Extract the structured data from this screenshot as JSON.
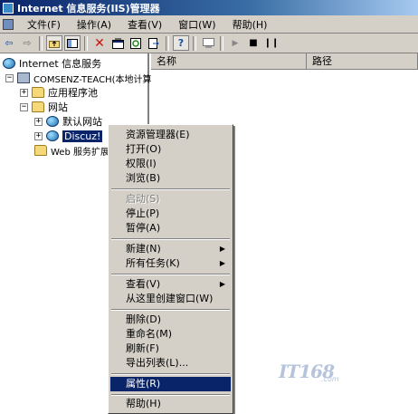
{
  "window": {
    "title": "Internet 信息服务(IIS)管理器"
  },
  "menubar": {
    "items": [
      "文件(F)",
      "操作(A)",
      "查看(V)",
      "窗口(W)",
      "帮助(H)"
    ]
  },
  "toolbar": {
    "buttons": [
      "back-arrow",
      "forward-arrow",
      "up-folder",
      "show-hide-tree",
      "delete",
      "properties",
      "refresh",
      "export-list",
      "help",
      "console",
      "play",
      "stop",
      "pause"
    ]
  },
  "tree": {
    "root": "Internet 信息服务",
    "computer": "COMSENZ-TEACH(本地计算",
    "app_pools": "应用程序池",
    "websites": "网站",
    "default_site": "默认网站",
    "selected_site": "Discuz!",
    "web_ext": "Web 服务扩展"
  },
  "list": {
    "columns": [
      "名称",
      "路径"
    ]
  },
  "context_menu": {
    "items": [
      {
        "label": "资源管理器(E)",
        "enabled": true
      },
      {
        "label": "打开(O)",
        "enabled": true
      },
      {
        "label": "权限(I)",
        "enabled": true
      },
      {
        "label": "浏览(B)",
        "enabled": true
      },
      {
        "label": "启动(S)",
        "enabled": false
      },
      {
        "label": "停止(P)",
        "enabled": true
      },
      {
        "label": "暂停(A)",
        "enabled": true
      },
      {
        "label": "新建(N)",
        "enabled": true,
        "submenu": true
      },
      {
        "label": "所有任务(K)",
        "enabled": true,
        "submenu": true
      },
      {
        "label": "查看(V)",
        "enabled": true,
        "submenu": true
      },
      {
        "label": "从这里创建窗口(W)",
        "enabled": true
      },
      {
        "label": "删除(D)",
        "enabled": true
      },
      {
        "label": "重命名(M)",
        "enabled": true
      },
      {
        "label": "刷新(F)",
        "enabled": true
      },
      {
        "label": "导出列表(L)...",
        "enabled": true
      },
      {
        "label": "属性(R)",
        "enabled": true,
        "highlighted": true
      },
      {
        "label": "帮助(H)",
        "enabled": true
      }
    ]
  },
  "watermark": {
    "text": "IT168",
    "sub": ".com"
  },
  "colors": {
    "title_bar": "#0a246a",
    "highlight": "#0a246a",
    "face": "#d4d0c8"
  }
}
